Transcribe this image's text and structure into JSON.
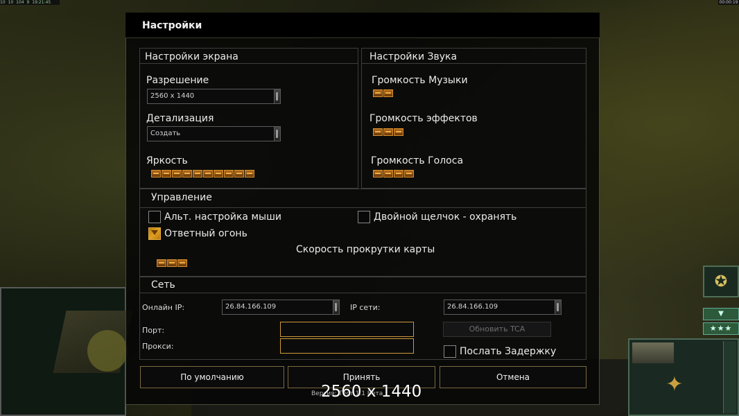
{
  "hud": {
    "topleft": [
      "10",
      "10",
      "104",
      "9",
      "19:21:45"
    ],
    "topright": "00:00:19",
    "rank_badge": "✪",
    "down_arrow": "▼",
    "stars": "★★★"
  },
  "dialog": {
    "title": "Настройки",
    "screen": {
      "header": "Настройки экрана",
      "resolution_label": "Разрешение",
      "resolution_value": "2560 x 1440",
      "detail_label": "Детализация",
      "detail_value": "Создать",
      "brightness_label": "Яркость",
      "brightness_level": 10
    },
    "sound": {
      "header": "Настройки Звука",
      "music_label": "Громкость Музыки",
      "music_level": 2,
      "effects_label": "Громкость эффектов",
      "effects_level": 3,
      "voice_label": "Громкость Голоса",
      "voice_level": 4
    },
    "controls": {
      "header": "Управление",
      "alt_mouse_label": "Альт. настройка мыши",
      "alt_mouse_checked": false,
      "double_click_label": "Двойной щелчок - охранять",
      "double_click_checked": false,
      "return_fire_label": "Ответный огонь",
      "return_fire_checked": true,
      "scroll_speed_label": "Скорость прокрутки карты",
      "scroll_speed_level": 3
    },
    "network": {
      "header": "Сеть",
      "online_ip_label": "Онлайн IP:",
      "online_ip_value": "26.84.166.109",
      "lan_ip_label": "IP сети:",
      "lan_ip_value": "26.84.166.109",
      "port_label": "Порт:",
      "port_value": "",
      "proxy_label": "Прокси:",
      "proxy_value": "",
      "update_button": "Обновить TCA",
      "send_delay_label": "Послать Задержку",
      "send_delay_checked": false
    },
    "buttons": {
      "default": "По умолчанию",
      "accept": "Принять",
      "cancel": "Отмена"
    },
    "version_text": "Версия: Тест 1.1 Бета"
  },
  "overlay": {
    "resolution": "2560 x 1440"
  },
  "colors": {
    "accent": "#d89030",
    "panel": "#0b0b0b",
    "hud_green": "#2d5a3a"
  }
}
